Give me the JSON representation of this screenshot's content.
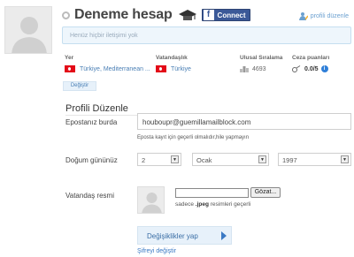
{
  "user": {
    "name": "Deneme hesap",
    "facebook_connect_label": "Connect",
    "profile_edit_label": "profili düzenle"
  },
  "status": {
    "placeholder": "Henüz hiçbir iletişimi yok"
  },
  "info": {
    "location_label": "Yer",
    "location_value": "Türkiye, Mediterranean ...",
    "citizenship_label": "Vatandaşlık",
    "citizenship_value": "Türkiye",
    "ranking_label": "Ulusal Sıralama",
    "ranking_value": "4693",
    "penalty_label": "Ceza puanları",
    "penalty_value": "0.0/5",
    "change_button_label": "Değiştir"
  },
  "form": {
    "section_title": "Profili Düzenle",
    "email_label": "Epostanız burda",
    "email_value": "houboupr@guemillamailblock.com",
    "email_note": "Eposta kayıt için geçerli olmalıdır,hile yapmayın",
    "birthday_label": "Doğum gününüz",
    "birth_day": "2",
    "birth_month": "Ocak",
    "birth_year": "1997",
    "photo_label": "Vatandaş resmi",
    "browse_label": "Gözat...",
    "upload_note_prefix": "sadece",
    "upload_note_format": ".jpeg",
    "upload_note_suffix": "resimleri geçerli",
    "save_label": "Değişiklikler yap",
    "change_password_label": "Şifreyi değiştir"
  }
}
